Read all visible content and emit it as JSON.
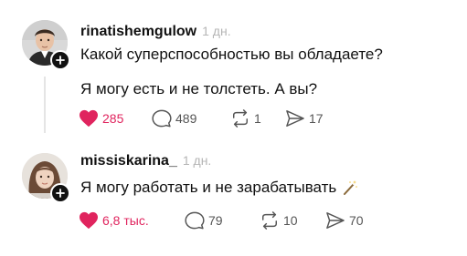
{
  "posts": [
    {
      "username": "rinatishemgulow",
      "time": "1 дн.",
      "lines": [
        "Какой суперспособностью вы обладаете?",
        "Я могу есть и не толстеть. А вы?"
      ],
      "likes": "285",
      "replies": "489",
      "reposts": "1",
      "shares": "17",
      "liked": true,
      "avatar_icon": "man-portrait-avatar",
      "follow_icon": "plus-icon"
    },
    {
      "username": "missiskarina_",
      "time": "1 дн.",
      "lines": [
        "Я могу работать и не зарабатывать"
      ],
      "emoji_icon": "magic-wand-icon",
      "likes": "6,8 тыс.",
      "replies": "79",
      "reposts": "10",
      "shares": "70",
      "liked": true,
      "avatar_icon": "woman-portrait-avatar",
      "follow_icon": "plus-icon"
    }
  ],
  "colors": {
    "like_red": "#e0245e",
    "text": "#111111",
    "muted": "#b5b5b5",
    "icon_grey": "#555555"
  }
}
